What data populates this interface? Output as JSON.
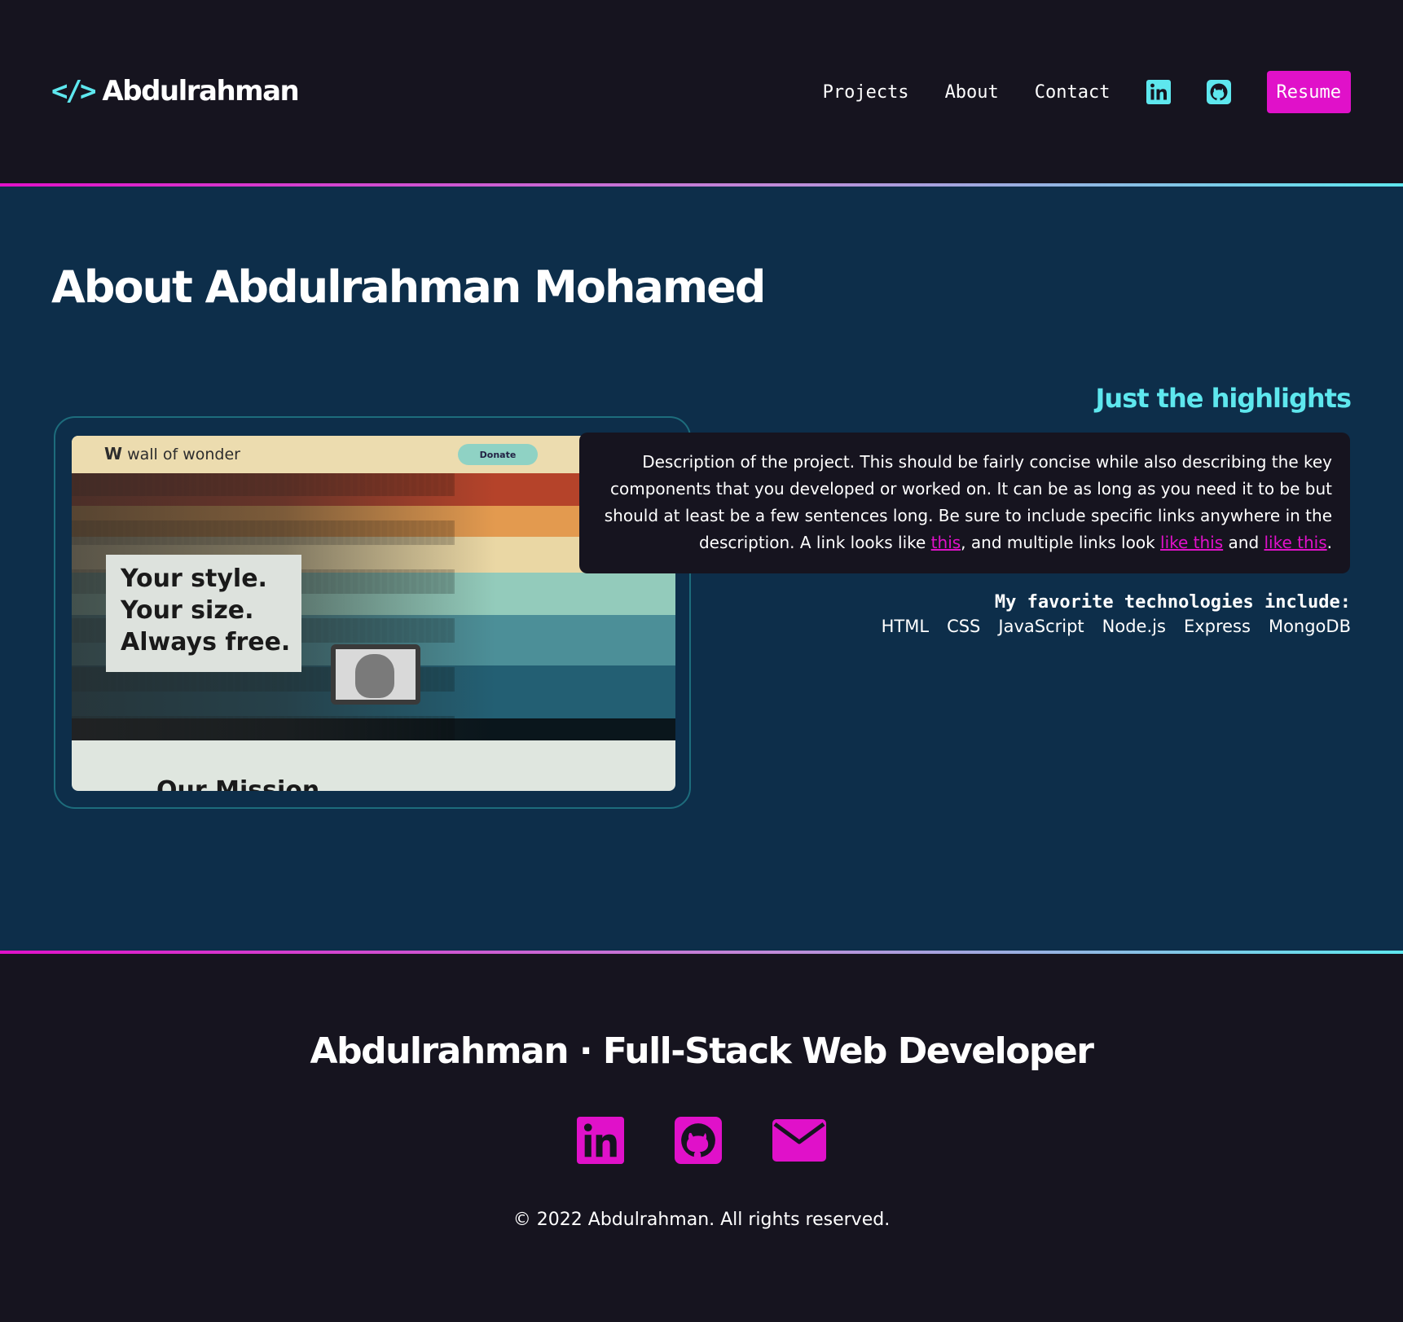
{
  "header": {
    "logo_icon": "</>",
    "logo_text": "Abdulrahman",
    "nav": [
      "Projects",
      "About",
      "Contact"
    ],
    "social_icons": [
      "linkedin-icon",
      "github-icon"
    ],
    "resume_label": "Resume"
  },
  "main": {
    "title": "About Abdulrahman Mohamed",
    "project_screenshot": {
      "logo": "wall of wonder",
      "donate_label": "Donate",
      "tagline": [
        "Your style.",
        "Your size.",
        "Always free."
      ],
      "mission_heading": "Our Mission"
    },
    "highlights_heading": "Just the highlights",
    "description": {
      "text_before": "Description of the project. This should be fairly concise while also describing the key components that you developed or worked on. It can be as long as you need it to be but should at least be a few sentences long. Be sure to include specific links anywhere in the description. A link looks like ",
      "link1": "this",
      "text_mid1": ", and multiple links look ",
      "link2": "like this",
      "text_mid2": " and ",
      "link3": "like this",
      "text_end": "."
    },
    "tech_heading": "My favorite technologies include:",
    "technologies": [
      "HTML",
      "CSS",
      "JavaScript",
      "Node.js",
      "Express",
      "MongoDB"
    ]
  },
  "footer": {
    "title": "Abdulrahman · Full-Stack Web Developer",
    "icons": [
      "linkedin-icon",
      "github-icon",
      "email-icon"
    ],
    "copyright": "© 2022 Abdulrahman. All rights reserved."
  },
  "colors": {
    "background_dark": "#16141f",
    "background_main": "#0d2e4a",
    "accent_magenta": "#e011c9",
    "accent_cyan": "#5ee7ee"
  }
}
